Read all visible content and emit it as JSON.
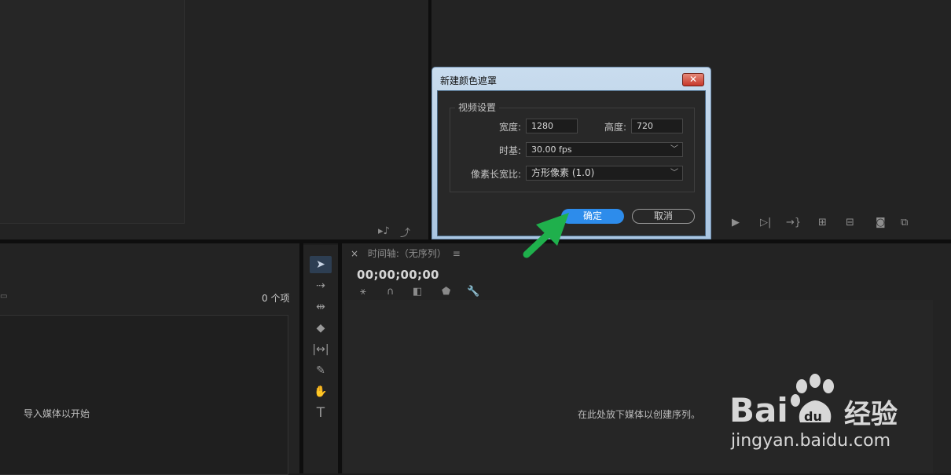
{
  "dialog": {
    "title": "新建颜色遮罩",
    "close_glyph": "✕",
    "group_label": "视频设置",
    "width_label": "宽度:",
    "width_value": "1280",
    "height_label": "高度:",
    "height_value": "720",
    "timebase_label": "时基:",
    "timebase_value": "30.00 fps",
    "pixel_aspect_label": "像素长宽比:",
    "pixel_aspect_value": "方形像素 (1.0)",
    "ok_label": "确定",
    "cancel_label": "取消"
  },
  "project": {
    "item_count": "0 个项",
    "empty_hint": "导入媒体以开始"
  },
  "timeline": {
    "close_glyph": "×",
    "title": "时间轴:（无序列）",
    "menu_glyph": "≡",
    "timecode": "00;00;00;00",
    "empty_hint": "在此处放下媒体以创建序列。"
  },
  "watermark": {
    "brand": "Bai",
    "brand_suffix": "经验",
    "url": "jingyan.baidu.com"
  },
  "colors": {
    "accent": "#2d8ceb",
    "arrow": "#1fb04c",
    "panel": "#232323",
    "background": "#1d1d1d"
  },
  "icons": {
    "source_monitor": [
      "audio-only-icon",
      "export-frame-icon"
    ],
    "program_monitor": [
      "play-icon",
      "step-forward-icon",
      "go-to-out-icon",
      "lift-icon",
      "extract-icon",
      "camera-icon",
      "compare-icon"
    ],
    "tools": [
      "selection-tool-icon",
      "track-select-tool-icon",
      "ripple-edit-tool-icon",
      "razor-tool-icon",
      "slip-tool-icon",
      "pen-tool-icon",
      "hand-tool-icon",
      "type-tool-icon"
    ],
    "timeline_tools": [
      "nest-icon",
      "snap-icon",
      "linked-selection-icon",
      "add-marker-icon",
      "settings-wrench-icon"
    ]
  }
}
